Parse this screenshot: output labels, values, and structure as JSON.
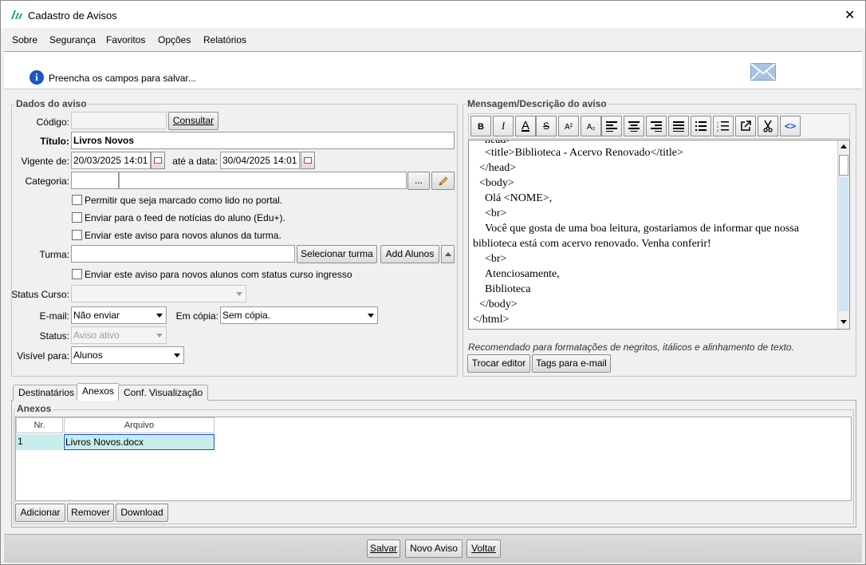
{
  "window": {
    "title": "Cadastro de Avisos",
    "close_glyph": "✕"
  },
  "menu": [
    "Sobre",
    "Segurança",
    "Favoritos",
    "Opções",
    "Relatórios"
  ],
  "info": {
    "message": "Preencha os campos para salvar..."
  },
  "dados": {
    "group_title": "Dados do aviso",
    "codigo_label": "Código:",
    "codigo_value": "",
    "consultar_label": "Consultar",
    "titulo_label": "Título:",
    "titulo_value": "Livros Novos",
    "vigente_label": "Vigente de:",
    "vigente_value": "20/03/2025 14:01",
    "ate_label": "até a data:",
    "ate_value": "30/04/2025 14:01",
    "categoria_label": "Categoria:",
    "categoria_code": "",
    "categoria_name": "",
    "categoria_browse": "...",
    "checkbox_portal": "Permitir que seja marcado como lido no portal.",
    "checkbox_feed": "Enviar para o feed de notícias do aluno (Edu+).",
    "checkbox_novos_turma": "Enviar este aviso para novos alunos da turma.",
    "turma_label": "Turma:",
    "turma_value": "",
    "selecionar_turma": "Selecionar turma",
    "add_alunos": "Add Alunos",
    "checkbox_ingresso": "Enviar este aviso para novos alunos com status curso ingresso",
    "status_curso_label": "Status Curso:",
    "status_curso_value": "",
    "email_label": "E-mail:",
    "email_value": "Não enviar",
    "copia_label": "Em cópia:",
    "copia_value": "Sem cópia.",
    "status_label": "Status:",
    "status_value": "Aviso ativo",
    "visivel_label": "Visível para:",
    "visivel_value": "Alunos"
  },
  "mensagem": {
    "group_title": "Mensagem/Descrição do aviso",
    "toolbar": {
      "bold": "B",
      "italic": "I",
      "font_color": "A",
      "strike": "S",
      "superscript": "A²",
      "subscript": "A₂",
      "code": "<>"
    },
    "code_lines": [
      "<title>Biblioteca - Acervo Renovado</title>",
      "</head>",
      "<body>",
      "Olá <NOME>,",
      "<br>",
      "Você que gosta de uma boa leitura, gostariamos de informar que nossa",
      "biblioteca está com acervo renovado. Venha conferir!",
      "<br>",
      "Atenciosamente,",
      "Biblioteca",
      "</body>",
      "</html>"
    ],
    "hint": "Recomendado para formatações de negritos, itálicos e alinhamento de texto.",
    "trocar_editor": "Trocar editor",
    "tags_email": "Tags para e-mail"
  },
  "tabs": [
    "Destinatários",
    "Anexos",
    "Conf. Visualização"
  ],
  "anexos": {
    "group_title": "Anexos",
    "columns": [
      "Nr.",
      "Arquivo"
    ],
    "rows": [
      {
        "nr": "1",
        "arquivo": "Livros Novos.docx"
      }
    ],
    "adicionar": "Adicionar",
    "remover": "Remover",
    "download": "Download"
  },
  "footer": {
    "salvar": "Salvar",
    "novo_aviso": "Novo Aviso",
    "voltar": "Voltar"
  },
  "colors": {
    "selected_row": "#c8ecec",
    "info_icon": "#1a56c8",
    "logo": "#1a9a8a"
  }
}
